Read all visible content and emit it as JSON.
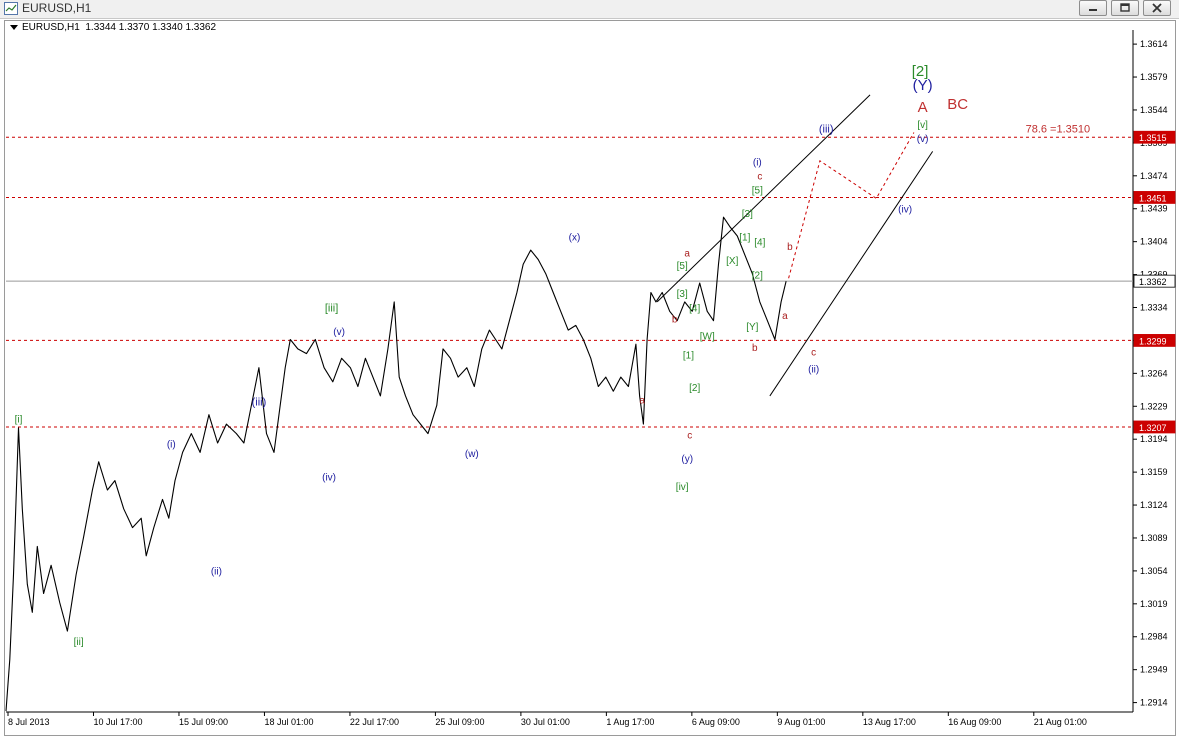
{
  "window": {
    "title": "EURUSD,H1",
    "minimize_icon": "minimize-icon",
    "restore_icon": "restore-icon",
    "close_icon": "close-icon"
  },
  "header": {
    "symbol": "EURUSD,H1",
    "ohlc": "1.3344 1.3370 1.3340 1.3362"
  },
  "chart_data": {
    "type": "line",
    "symbol": "EURUSD",
    "timeframe": "H1",
    "ylim": [
      1.2904,
      1.3629
    ],
    "y_ticks": [
      1.3614,
      1.3579,
      1.3544,
      1.3509,
      1.3474,
      1.3439,
      1.3404,
      1.3369,
      1.3334,
      1.3299,
      1.3264,
      1.3229,
      1.3194,
      1.3159,
      1.3124,
      1.3089,
      1.3054,
      1.3019,
      1.2984,
      1.2949,
      1.2914
    ],
    "x_ticks": [
      "8 Jul 2013",
      "10 Jul 17:00",
      "15 Jul 09:00",
      "18 Jul 01:00",
      "22 Jul 17:00",
      "25 Jul 09:00",
      "30 Jul 01:00",
      "1 Aug 17:00",
      "6 Aug 09:00",
      "9 Aug 01:00",
      "13 Aug 17:00",
      "16 Aug 09:00",
      "21 Aug 01:00"
    ],
    "grid": false,
    "current_price": 1.3362,
    "series": [
      {
        "color": "#000000",
        "points": [
          [
            0.0,
            1.2905
          ],
          [
            0.3,
            1.296
          ],
          [
            0.6,
            1.305
          ],
          [
            1.0,
            1.3206
          ],
          [
            1.3,
            1.312
          ],
          [
            1.7,
            1.304
          ],
          [
            2.1,
            1.301
          ],
          [
            2.5,
            1.308
          ],
          [
            3.0,
            1.303
          ],
          [
            3.6,
            1.306
          ],
          [
            4.3,
            1.302
          ],
          [
            4.9,
            1.299
          ],
          [
            5.6,
            1.305
          ],
          [
            6.2,
            1.309
          ],
          [
            6.9,
            1.314
          ],
          [
            7.4,
            1.317
          ],
          [
            8.1,
            1.314
          ],
          [
            8.7,
            1.315
          ],
          [
            9.4,
            1.312
          ],
          [
            10.1,
            1.31
          ],
          [
            10.8,
            1.311
          ],
          [
            11.2,
            1.307
          ],
          [
            11.8,
            1.31
          ],
          [
            12.5,
            1.313
          ],
          [
            13.0,
            1.311
          ],
          [
            13.5,
            1.315
          ],
          [
            14.1,
            1.318
          ],
          [
            14.8,
            1.32
          ],
          [
            15.5,
            1.318
          ],
          [
            16.2,
            1.322
          ],
          [
            16.9,
            1.319
          ],
          [
            17.6,
            1.321
          ],
          [
            18.4,
            1.32
          ],
          [
            19.0,
            1.319
          ],
          [
            19.6,
            1.323
          ],
          [
            20.2,
            1.327
          ],
          [
            20.8,
            1.32
          ],
          [
            21.4,
            1.318
          ],
          [
            21.9,
            1.323
          ],
          [
            22.3,
            1.327
          ],
          [
            22.7,
            1.33
          ],
          [
            23.3,
            1.329
          ],
          [
            24.0,
            1.3285
          ],
          [
            24.7,
            1.33
          ],
          [
            25.4,
            1.327
          ],
          [
            26.1,
            1.3255
          ],
          [
            26.8,
            1.328
          ],
          [
            27.5,
            1.327
          ],
          [
            28.1,
            1.325
          ],
          [
            28.7,
            1.328
          ],
          [
            29.3,
            1.326
          ],
          [
            29.9,
            1.324
          ],
          [
            30.5,
            1.329
          ],
          [
            31.0,
            1.334
          ],
          [
            31.4,
            1.326
          ],
          [
            31.9,
            1.324
          ],
          [
            32.5,
            1.322
          ],
          [
            33.1,
            1.321
          ],
          [
            33.7,
            1.32
          ],
          [
            34.4,
            1.323
          ],
          [
            34.9,
            1.329
          ],
          [
            35.5,
            1.328
          ],
          [
            36.1,
            1.326
          ],
          [
            36.8,
            1.327
          ],
          [
            37.4,
            1.325
          ],
          [
            38.0,
            1.329
          ],
          [
            38.6,
            1.331
          ],
          [
            39.1,
            1.33
          ],
          [
            39.6,
            1.329
          ],
          [
            40.2,
            1.332
          ],
          [
            40.8,
            1.335
          ],
          [
            41.3,
            1.338
          ],
          [
            41.9,
            1.3395
          ],
          [
            42.5,
            1.3385
          ],
          [
            43.1,
            1.337
          ],
          [
            43.7,
            1.335
          ],
          [
            44.3,
            1.333
          ],
          [
            44.9,
            1.331
          ],
          [
            45.5,
            1.3315
          ],
          [
            46.1,
            1.33
          ],
          [
            46.7,
            1.328
          ],
          [
            47.3,
            1.325
          ],
          [
            47.9,
            1.326
          ],
          [
            48.5,
            1.3245
          ],
          [
            49.1,
            1.326
          ],
          [
            49.7,
            1.325
          ],
          [
            50.3,
            1.3295
          ],
          [
            50.6,
            1.324
          ],
          [
            50.9,
            1.321
          ],
          [
            51.2,
            1.33
          ],
          [
            51.5,
            1.335
          ],
          [
            51.9,
            1.334
          ],
          [
            52.4,
            1.335
          ],
          [
            53.0,
            1.333
          ],
          [
            53.6,
            1.332
          ],
          [
            54.2,
            1.334
          ],
          [
            54.8,
            1.333
          ],
          [
            55.4,
            1.336
          ],
          [
            56.0,
            1.333
          ],
          [
            56.5,
            1.332
          ],
          [
            56.9,
            1.338
          ],
          [
            57.3,
            1.343
          ],
          [
            57.8,
            1.342
          ],
          [
            58.4,
            1.341
          ],
          [
            59.0,
            1.339
          ],
          [
            59.6,
            1.337
          ],
          [
            60.2,
            1.334
          ],
          [
            60.8,
            1.332
          ],
          [
            61.4,
            1.33
          ],
          [
            61.9,
            1.334
          ],
          [
            62.3,
            1.3362
          ]
        ]
      }
    ],
    "h_levels": [
      {
        "value": 1.3515,
        "label": "1.3515",
        "style": "dashed",
        "color": "#cc0000"
      },
      {
        "value": 1.3451,
        "label": "1.3451",
        "style": "dashed",
        "color": "#cc0000"
      },
      {
        "value": 1.3299,
        "label": "1.3299",
        "style": "dashed",
        "color": "#cc0000"
      },
      {
        "value": 1.3207,
        "label": "1.3207",
        "style": "dashed",
        "color": "#cc0000"
      },
      {
        "value": 1.3362,
        "label": "1.3362",
        "style": "solid",
        "color": "#999999"
      }
    ],
    "trend_lines": [
      {
        "from": [
          52.0,
          1.334
        ],
        "to": [
          69.0,
          1.356
        ],
        "color": "#000000"
      },
      {
        "from": [
          61.0,
          1.324
        ],
        "to": [
          74.0,
          1.35
        ],
        "color": "#000000"
      }
    ],
    "projection": {
      "color": "#cc0000",
      "points": [
        [
          62.5,
          1.3365
        ],
        [
          65.0,
          1.349
        ],
        [
          69.5,
          1.345
        ],
        [
          72.5,
          1.352
        ]
      ]
    },
    "annotations": [
      {
        "text": "[i]",
        "x": 1.0,
        "y": 1.3212,
        "color": "#2a8a2a"
      },
      {
        "text": "[ii]",
        "x": 5.8,
        "y": 1.2975,
        "color": "#2a8a2a"
      },
      {
        "text": "[iii]",
        "x": 26.0,
        "y": 1.333,
        "color": "#2a8a2a"
      },
      {
        "text": "[iv]",
        "x": 54.0,
        "y": 1.314,
        "color": "#2a8a2a"
      },
      {
        "text": "[2]",
        "x": 73.0,
        "y": 1.358,
        "color": "#2a8a2a"
      },
      {
        "text": "[v]",
        "x": 73.2,
        "y": 1.3525,
        "color": "#2a8a2a"
      },
      {
        "text": "[1]",
        "x": 59.0,
        "y": 1.3405,
        "color": "#2a8a2a"
      },
      {
        "text": "[2]",
        "x": 60.0,
        "y": 1.3365,
        "color": "#2a8a2a"
      },
      {
        "text": "[3]",
        "x": 59.2,
        "y": 1.343,
        "color": "#2a8a2a"
      },
      {
        "text": "[4]",
        "x": 60.2,
        "y": 1.34,
        "color": "#2a8a2a"
      },
      {
        "text": "[5]",
        "x": 60.0,
        "y": 1.3455,
        "color": "#2a8a2a"
      },
      {
        "text": "[3]",
        "x": 54.0,
        "y": 1.3345,
        "color": "#2a8a2a"
      },
      {
        "text": "[4]",
        "x": 55.0,
        "y": 1.333,
        "color": "#2a8a2a"
      },
      {
        "text": "[5]",
        "x": 54.0,
        "y": 1.3375,
        "color": "#2a8a2a"
      },
      {
        "text": "[X]",
        "x": 58.0,
        "y": 1.338,
        "color": "#2a8a2a"
      },
      {
        "text": "[W]",
        "x": 56.0,
        "y": 1.33,
        "color": "#2a8a2a"
      },
      {
        "text": "[Y]",
        "x": 59.6,
        "y": 1.331,
        "color": "#2a8a2a"
      },
      {
        "text": "[1]",
        "x": 54.5,
        "y": 1.328,
        "color": "#2a8a2a"
      },
      {
        "text": "[2]",
        "x": 55.0,
        "y": 1.3245,
        "color": "#2a8a2a"
      },
      {
        "text": "(i)",
        "x": 13.2,
        "y": 1.3185,
        "color": "#2020a0"
      },
      {
        "text": "(ii)",
        "x": 16.8,
        "y": 1.305,
        "color": "#2020a0"
      },
      {
        "text": "(iii)",
        "x": 20.2,
        "y": 1.323,
        "color": "#2020a0"
      },
      {
        "text": "(iv)",
        "x": 25.8,
        "y": 1.315,
        "color": "#2020a0"
      },
      {
        "text": "(v)",
        "x": 26.6,
        "y": 1.3305,
        "color": "#2020a0"
      },
      {
        "text": "(w)",
        "x": 37.2,
        "y": 1.3175,
        "color": "#2020a0"
      },
      {
        "text": "(x)",
        "x": 45.4,
        "y": 1.3405,
        "color": "#2020a0"
      },
      {
        "text": "(y)",
        "x": 54.4,
        "y": 1.317,
        "color": "#2020a0"
      },
      {
        "text": "(i)",
        "x": 60.0,
        "y": 1.3485,
        "color": "#2020a0"
      },
      {
        "text": "(ii)",
        "x": 64.5,
        "y": 1.3265,
        "color": "#2020a0"
      },
      {
        "text": "(iii)",
        "x": 65.5,
        "y": 1.352,
        "color": "#2020a0"
      },
      {
        "text": "(iv)",
        "x": 71.8,
        "y": 1.3435,
        "color": "#2020a0"
      },
      {
        "text": "(v)",
        "x": 73.2,
        "y": 1.351,
        "color": "#2020a0"
      },
      {
        "text": "(Y)",
        "x": 73.2,
        "y": 1.3565,
        "color": "#2020a0"
      },
      {
        "text": "a",
        "x": 50.8,
        "y": 1.3232,
        "color": "#aa2020"
      },
      {
        "text": "b",
        "x": 53.4,
        "y": 1.3318,
        "color": "#aa2020"
      },
      {
        "text": "c",
        "x": 54.6,
        "y": 1.3195,
        "color": "#aa2020"
      },
      {
        "text": "a",
        "x": 54.4,
        "y": 1.3388,
        "color": "#aa2020"
      },
      {
        "text": "b",
        "x": 59.8,
        "y": 1.3288,
        "color": "#aa2020"
      },
      {
        "text": "c",
        "x": 60.2,
        "y": 1.347,
        "color": "#aa2020"
      },
      {
        "text": "a",
        "x": 62.2,
        "y": 1.3322,
        "color": "#aa2020"
      },
      {
        "text": "b",
        "x": 62.6,
        "y": 1.3395,
        "color": "#aa2020"
      },
      {
        "text": "c",
        "x": 64.5,
        "y": 1.3283,
        "color": "#aa2020"
      },
      {
        "text": "A",
        "x": 73.2,
        "y": 1.3542,
        "color": "#c03030"
      },
      {
        "text": "BC",
        "x": 76.0,
        "y": 1.3545,
        "color": "#c03030"
      },
      {
        "text": "78.6 =1.3510",
        "x": 84.0,
        "y": 1.352,
        "color": "#c03030"
      }
    ]
  }
}
